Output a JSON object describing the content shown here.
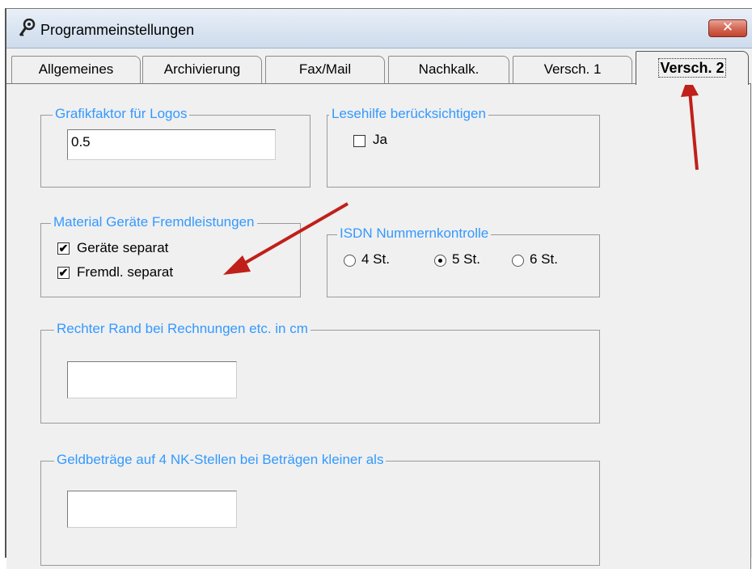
{
  "window": {
    "title": "Programmeinstellungen",
    "close_label": "✕"
  },
  "tabs": [
    {
      "label": "Allgemeines",
      "active": false
    },
    {
      "label": "Archivierung",
      "active": false
    },
    {
      "label": "Fax/Mail",
      "active": false
    },
    {
      "label": "Nachkalk.",
      "active": false
    },
    {
      "label": "Versch. 1",
      "active": false
    },
    {
      "label": "Versch. 2",
      "active": true
    }
  ],
  "groups": {
    "grafikfaktor": {
      "title": "Grafikfaktor für Logos",
      "value": "0.5"
    },
    "lesehilfe": {
      "title": "Lesehilfe berücksichtigen",
      "checkbox_label": "Ja",
      "checked": false
    },
    "material": {
      "title": "Material Geräte Fremdleistungen",
      "items": [
        {
          "label": "Geräte separat",
          "checked": true
        },
        {
          "label": "Fremdl. separat",
          "checked": true
        }
      ]
    },
    "isdn": {
      "title": "ISDN Nummernkontrolle",
      "options": [
        {
          "label": "4 St.",
          "selected": false
        },
        {
          "label": "5 St.",
          "selected": true
        },
        {
          "label": "6 St.",
          "selected": false
        }
      ]
    },
    "rechter_rand": {
      "title": "Rechter Rand bei Rechnungen etc. in cm",
      "value": ""
    },
    "geldbetraege": {
      "title": "Geldbeträge auf 4 NK-Stellen bei Beträgen kleiner als",
      "value": ""
    }
  },
  "check_mark": "✔",
  "colors": {
    "group_title": "#3399ff",
    "annotation_arrow": "#c0201a",
    "close_button": "#c2432e"
  }
}
